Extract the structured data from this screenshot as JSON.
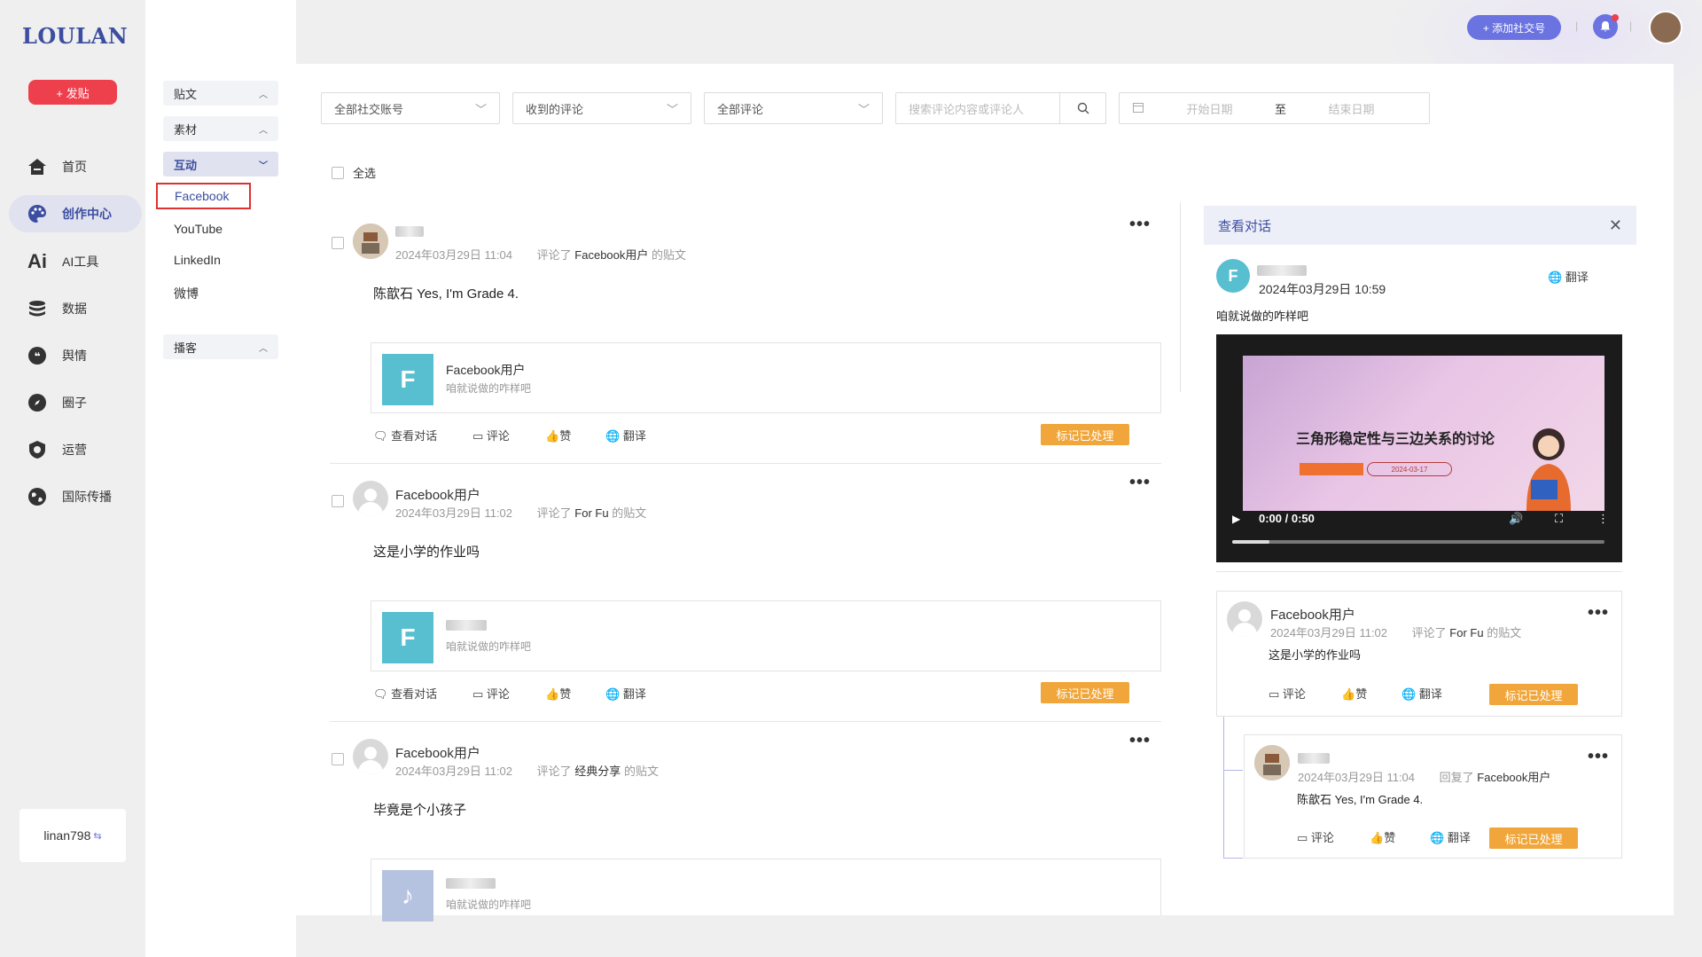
{
  "app": {
    "logo": "LOULAN"
  },
  "leftnav": {
    "post_label": "+ 发贴",
    "items": [
      {
        "label": "首页",
        "icon": "home-icon"
      },
      {
        "label": "创作中心",
        "icon": "palette-icon",
        "active": true
      },
      {
        "label": "AI工具",
        "icon": "ai-icon"
      },
      {
        "label": "数据",
        "icon": "database-icon"
      },
      {
        "label": "舆情",
        "icon": "quote-icon"
      },
      {
        "label": "圈子",
        "icon": "compass-icon"
      },
      {
        "label": "运营",
        "icon": "shield-icon"
      },
      {
        "label": "国际传播",
        "icon": "globe-icon"
      }
    ],
    "user": "linan798"
  },
  "subnav": {
    "groups": [
      {
        "label": "贴文",
        "open": false
      },
      {
        "label": "素材",
        "open": false
      },
      {
        "label": "互动",
        "open": true
      },
      {
        "label": "播客",
        "open": false
      }
    ],
    "items": [
      "Facebook",
      "YouTube",
      "LinkedIn",
      "微博"
    ]
  },
  "topbar": {
    "add_social": "+ 添加社交号"
  },
  "filters": {
    "account": "全部社交账号",
    "received": "收到的评论",
    "all_comments": "全部评论",
    "search_placeholder": "搜索评论内容或评论人",
    "start_date": "开始日期",
    "to": "至",
    "end_date": "结束日期"
  },
  "select_all": "全选",
  "comments": [
    {
      "name": "",
      "time": "2024年03月29日 11:04",
      "commented": "评论了",
      "target": "Facebook用户",
      "suffix": "的贴文",
      "text": "陈歆石 Yes, I'm Grade 4.",
      "quote_name": "Facebook用户",
      "quote_text": "咱就说做的咋样吧"
    },
    {
      "name": "Facebook用户",
      "time": "2024年03月29日 11:02",
      "commented": "评论了",
      "target": "For Fu",
      "suffix": "的贴文",
      "text": "这是小学的作业吗",
      "quote_name": "",
      "quote_text": "咱就说做的咋样吧"
    },
    {
      "name": "Facebook用户",
      "time": "2024年03月29日 11:02",
      "commented": "评论了",
      "target": "经典分享",
      "suffix": "的贴文",
      "text": "毕竟是个小孩子",
      "quote_name": "",
      "quote_text": "咱就说做的咋样吧"
    }
  ],
  "actions": {
    "view": "查看对话",
    "comment": "评论",
    "like": "赞",
    "translate": "翻译",
    "mark": "标记已处理"
  },
  "panel": {
    "title": "查看对话",
    "post_time": "2024年03月29日 10:59",
    "post_text": "咱就说做的咋样吧",
    "translate": "翻译",
    "video_title": "三角形稳定性与三边关系的讨论",
    "video_date": "2024-03-17",
    "video_time": "0:00 / 0:50",
    "video_progress": 0.1,
    "reply1": {
      "name": "Facebook用户",
      "time": "2024年03月29日 11:02",
      "commented": "评论了",
      "target": "For Fu",
      "suffix": "的贴文",
      "text": "这是小学的作业吗"
    },
    "reply2": {
      "time": "2024年03月29日 11:04",
      "replied": "回复了",
      "target": "Facebook用户",
      "text": "陈歆石 Yes, I'm Grade 4."
    }
  }
}
